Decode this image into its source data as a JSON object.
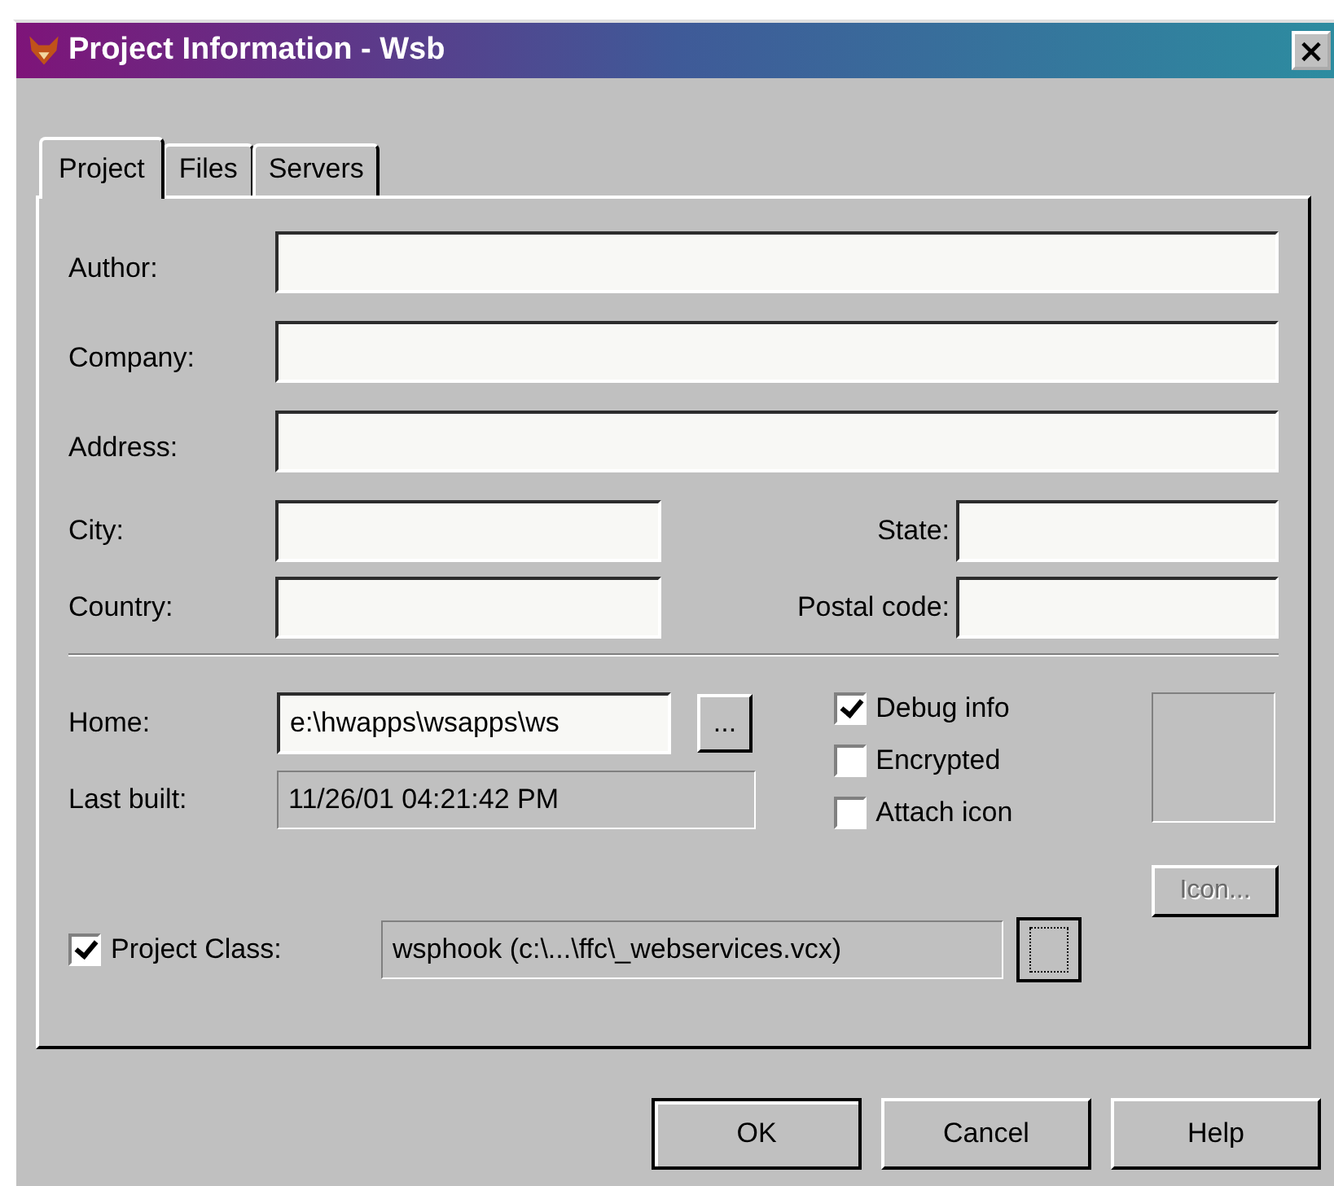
{
  "window": {
    "title": "Project Information - Wsb",
    "close": "×"
  },
  "tabs": [
    {
      "label": "Project",
      "selected": true
    },
    {
      "label": "Files",
      "selected": false
    },
    {
      "label": "Servers",
      "selected": false
    }
  ],
  "wide_fields": [
    {
      "label": "Author:"
    },
    {
      "label": "Company:"
    },
    {
      "label": "Address:"
    }
  ],
  "pair_rows": [
    [
      {
        "label": "City:"
      },
      {
        "label": "State:"
      }
    ],
    [
      {
        "label": "Country:"
      },
      {
        "label": "Postal code:"
      }
    ]
  ],
  "home": {
    "label": "Home:",
    "value": "e:\\hwapps\\wsapps\\ws",
    "browse": "..."
  },
  "last_built": {
    "label": "Last built:",
    "value": "11/26/01 04:21:42 PM"
  },
  "options": [
    {
      "label": "Debug info",
      "checked": true
    },
    {
      "label": "Encrypted",
      "checked": false
    },
    {
      "label": "Attach icon",
      "checked": false
    }
  ],
  "icon_button": {
    "label": "Icon...",
    "disabled": true
  },
  "project_class": {
    "label": "Project Class:",
    "checked": true,
    "value": "wsphook (c:\\...\\ffc\\_webservices.vcx)"
  },
  "buttons": [
    {
      "label": "OK",
      "default": true
    },
    {
      "label": "Cancel",
      "default": false
    },
    {
      "label": "Help",
      "default": false
    }
  ]
}
